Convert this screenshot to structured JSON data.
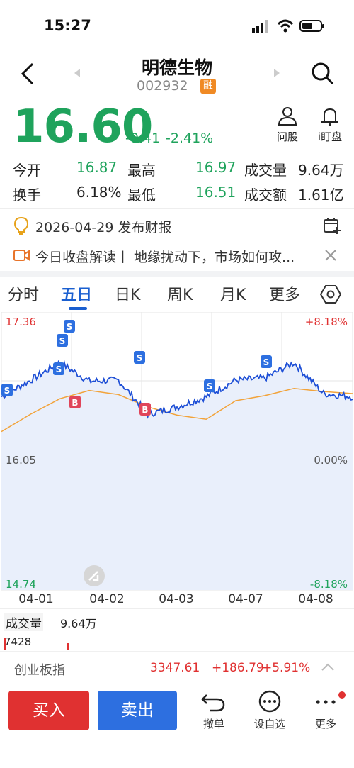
{
  "status": {
    "time": "15:27"
  },
  "header": {
    "name": "明德生物",
    "code": "002932",
    "badge": "融"
  },
  "quote": {
    "price": "16.60",
    "change": "-0.41",
    "change_pct": "-2.41%"
  },
  "tools": {
    "ask": "问股",
    "watch": "i盯盘"
  },
  "stats": {
    "open_label": "今开",
    "open": "16.87",
    "high_label": "最高",
    "high": "16.97",
    "volume_label": "成交量",
    "volume": "9.64万",
    "turnover_label": "换手",
    "turnover": "6.18%",
    "low_label": "最低",
    "low": "16.51",
    "amount_label": "成交额",
    "amount": "1.61亿"
  },
  "notice": {
    "report": "2026-04-29 发布财报",
    "news": "今日收盘解读丨 地缘扰动下，市场如何攻..."
  },
  "tabs": [
    "分时",
    "五日",
    "日K",
    "周K",
    "月K",
    "更多"
  ],
  "chart": {
    "y_top": "17.36",
    "y_mid": "16.05",
    "y_bottom": "14.74",
    "pct_top": "+8.18%",
    "pct_mid": "0.00%",
    "pct_bottom": "-8.18%",
    "dates": [
      "04-01",
      "04-02",
      "04-03",
      "04-07",
      "04-08"
    ]
  },
  "chart_data": {
    "type": "line",
    "x": [
      "04-01",
      "04-02",
      "04-03",
      "04-07",
      "04-08"
    ],
    "ylim": [
      14.74,
      17.36
    ],
    "y_ref": 16.05,
    "series": [
      {
        "values": [
          16.62,
          16.78,
          16.95,
          16.77,
          16.78,
          16.45,
          16.52,
          16.62,
          16.78,
          16.8,
          16.95,
          16.65,
          16.62
        ]
      },
      {
        "values": [
          16.28,
          16.45,
          16.6,
          16.68,
          16.64,
          16.52,
          16.44,
          16.4,
          16.58,
          16.63,
          16.7,
          16.67,
          16.65
        ]
      }
    ]
  },
  "volume": {
    "label": "成交量",
    "value": "9.64万",
    "scale": "7428"
  },
  "index": {
    "name": "创业板指",
    "value": "3347.61",
    "change": "+186.79",
    "pct": "+5.91%"
  },
  "actions": {
    "buy": "买入",
    "sell": "卖出",
    "undo": "撤单",
    "watchlist": "设自选",
    "more": "更多"
  },
  "colors": {
    "green": "#1fa35c",
    "red": "#e03131",
    "blue": "#1a5fd0",
    "buy_bg": "#e03131",
    "sell_bg": "#2d6fe0"
  }
}
